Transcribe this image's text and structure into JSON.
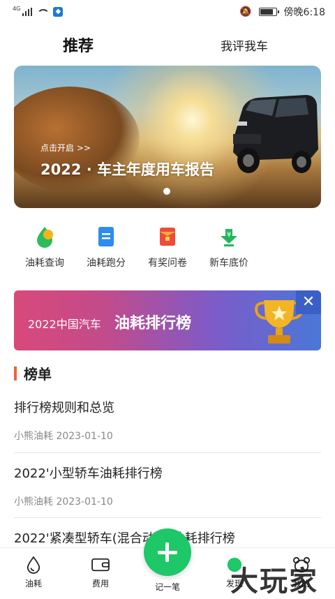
{
  "status_bar": {
    "network": "4G",
    "time": "傍晚6:18"
  },
  "tabs": {
    "recommend": "推荐",
    "review": "我评我车"
  },
  "banner": {
    "subtitle": "点击开启 >>",
    "title": "2022 · 车主年度用车报告"
  },
  "features": [
    {
      "label": "油耗查询",
      "icon": "fuel-drop-icon"
    },
    {
      "label": "油耗跑分",
      "icon": "document-icon"
    },
    {
      "label": "有奖问卷",
      "icon": "red-envelope-icon"
    },
    {
      "label": "新车底价",
      "icon": "price-tag-icon"
    }
  ],
  "promo": {
    "year_text": "2022中国汽车",
    "title": "油耗排行榜",
    "close": "✕"
  },
  "section": {
    "title": "榜单"
  },
  "articles": [
    {
      "title": "排行榜规则和总览",
      "meta": "小熊油耗  2023-01-10"
    },
    {
      "title": "2022'小型轿车油耗排行榜",
      "meta": "小熊油耗 2023-01-10"
    },
    {
      "title": "2022'紧凑型轿车(混合动力)油耗排行榜",
      "meta": ""
    }
  ],
  "bottom_nav": {
    "fuel": "油耗",
    "expense": "费用",
    "add": "记一笔",
    "discover": "发现",
    "mine": "我的"
  },
  "watermark": "大玩家",
  "colors": {
    "accent_green": "#1ec768",
    "section_bar": "#f0613a",
    "promo_start": "#d8497a",
    "promo_end": "#4a77d8"
  }
}
